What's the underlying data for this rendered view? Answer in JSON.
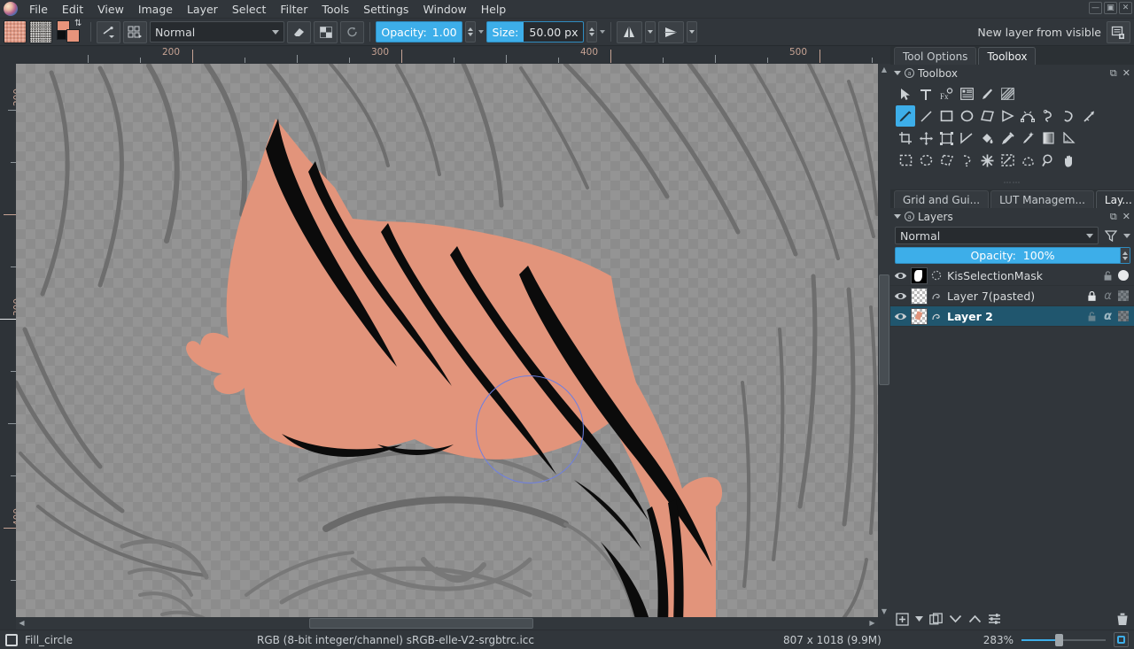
{
  "menu": {
    "items": [
      "File",
      "Edit",
      "View",
      "Image",
      "Layer",
      "Select",
      "Filter",
      "Tools",
      "Settings",
      "Window",
      "Help"
    ]
  },
  "window_controls": {
    "minimize": "—",
    "maximize": "▣",
    "close": "✕"
  },
  "toolbar": {
    "pattern_swatch_name": "brush-pattern-swatch",
    "texture_swatch_name": "texture-pattern-swatch",
    "blend_mode": "Normal",
    "opacity_label": "Opacity:",
    "opacity_value": "1.00",
    "size_label": "Size:",
    "size_value": "50.00 px",
    "eraser_icon": "eraser-icon",
    "alpha_icon": "preserve-alpha-icon",
    "reset_icon": "reload-preset-icon",
    "mirror_h_icon": "mirror-horizontal-icon",
    "mirror_v_icon": "mirror-vertical-icon",
    "brush_editor_icon": "brush-editor-icon",
    "preset_chooser_icon": "preset-chooser-icon",
    "right_action_label": "New layer from visible",
    "right_action_icon": "new-layer-from-visible-icon"
  },
  "rulers": {
    "horizontal_labels": [
      "200",
      "300",
      "400",
      "500"
    ],
    "vertical_labels": [
      "200",
      "300",
      "400"
    ],
    "unit": "px"
  },
  "canvas": {
    "brush_cursor_name": "brush-outline-cursor",
    "artwork_description": "anime hair lineart with peach fill"
  },
  "dock": {
    "top_tabs": [
      {
        "label": "Tool Options",
        "active": false,
        "name": "tab-tool-options"
      },
      {
        "label": "Toolbox",
        "active": true,
        "name": "tab-toolbox"
      }
    ],
    "toolbox": {
      "title": "Toolbox",
      "float_icon": "undock-icon",
      "close_icon": "close-icon",
      "tools": [
        [
          {
            "name": "shape-select-tool",
            "icon": "cursor-arrow-icon",
            "selected": false
          },
          {
            "name": "text-tool",
            "icon": "text-icon",
            "selected": false
          },
          {
            "name": "edit-shapes-tool",
            "icon": "fx-icon",
            "selected": false
          },
          {
            "name": "reference-images-tool",
            "icon": "reference-images-icon",
            "selected": false
          },
          {
            "name": "calligraphy-tool",
            "icon": "calligraphy-icon",
            "selected": false
          },
          {
            "name": "gradient-tool",
            "icon": "pattern-fill-icon",
            "selected": false
          }
        ],
        [
          {
            "name": "freehand-brush-tool",
            "icon": "brush-icon",
            "selected": true
          },
          {
            "name": "line-tool",
            "icon": "line-icon",
            "selected": false
          },
          {
            "name": "rectangle-tool",
            "icon": "rectangle-icon",
            "selected": false
          },
          {
            "name": "ellipse-tool",
            "icon": "ellipse-icon",
            "selected": false
          },
          {
            "name": "polygon-tool",
            "icon": "polygon-icon",
            "selected": false
          },
          {
            "name": "polyline-tool",
            "icon": "polyline-icon",
            "selected": false
          },
          {
            "name": "bezier-curve-tool",
            "icon": "bezier-curve-icon",
            "selected": false
          },
          {
            "name": "freehand-path-tool",
            "icon": "freehand-path-icon",
            "selected": false
          },
          {
            "name": "dynamic-brush-tool",
            "icon": "dynamic-brush-icon",
            "selected": false
          },
          {
            "name": "multibrush-tool",
            "icon": "multibrush-icon",
            "selected": false
          }
        ],
        [
          {
            "name": "crop-tool",
            "icon": "crop-icon",
            "selected": false
          },
          {
            "name": "move-tool",
            "icon": "move-icon",
            "selected": false
          },
          {
            "name": "transform-tool",
            "icon": "transform-icon",
            "selected": false
          },
          {
            "name": "measure-tool",
            "icon": "measure-icon",
            "selected": false
          },
          {
            "name": "fill-tool",
            "icon": "paint-bucket-icon",
            "selected": false
          },
          {
            "name": "color-picker-tool",
            "icon": "eyedropper-icon",
            "selected": false
          },
          {
            "name": "smart-patch-tool",
            "icon": "smart-patch-icon",
            "selected": false
          },
          {
            "name": "gradient-fill-tool",
            "icon": "gradient-icon",
            "selected": false
          },
          {
            "name": "assistant-tool",
            "icon": "assistant-ruler-icon",
            "selected": false
          }
        ],
        [
          {
            "name": "rectangular-selection-tool",
            "icon": "select-rect-icon",
            "selected": false
          },
          {
            "name": "elliptical-selection-tool",
            "icon": "select-ellipse-icon",
            "selected": false
          },
          {
            "name": "polygonal-selection-tool",
            "icon": "select-polygon-icon",
            "selected": false
          },
          {
            "name": "freehand-selection-tool",
            "icon": "select-freehand-icon",
            "selected": false
          },
          {
            "name": "contiguous-selection-tool",
            "icon": "magic-wand-icon",
            "selected": false
          },
          {
            "name": "similar-color-selection-tool",
            "icon": "select-similar-icon",
            "selected": false
          },
          {
            "name": "bezier-selection-tool",
            "icon": "select-bezier-icon",
            "selected": false
          },
          {
            "name": "zoom-tool",
            "icon": "magnifier-icon",
            "selected": false
          },
          {
            "name": "pan-tool",
            "icon": "hand-icon",
            "selected": false
          }
        ]
      ]
    },
    "mid_tabs": [
      {
        "label": "Grid and Gui...",
        "active": false,
        "name": "tab-grid-and-guides"
      },
      {
        "label": "LUT Managem...",
        "active": false,
        "name": "tab-lut-management"
      },
      {
        "label": "Lay...",
        "active": true,
        "name": "tab-layers"
      }
    ],
    "layers": {
      "title": "Layers",
      "float_icon": "undock-icon",
      "close_icon": "close-icon",
      "blend_mode": "Normal",
      "filter_icon": "filter-funnel-icon",
      "opacity_label": "Opacity:",
      "opacity_value": "100%",
      "rows": [
        {
          "name": "KisSelectionMask",
          "visible": true,
          "selected": false,
          "thumb_type": "mask",
          "type_icon": "selection-mask-icon",
          "locked": false,
          "has_alpha_lock": false,
          "has_dot": true
        },
        {
          "name": "Layer 7(pasted)",
          "visible": true,
          "selected": false,
          "thumb_type": "checker",
          "type_icon": "paint-layer-icon",
          "locked": true,
          "has_alpha_lock": true,
          "has_dot": false
        },
        {
          "name": "Layer 2",
          "visible": true,
          "selected": true,
          "thumb_type": "checker",
          "type_icon": "paint-layer-icon",
          "locked": false,
          "has_alpha_lock": true,
          "has_dot": false
        }
      ],
      "toolbar_buttons": [
        {
          "name": "add-layer-button",
          "icon": "plus-box-icon"
        },
        {
          "name": "add-layer-dropdown",
          "icon": "chevron-down-icon"
        },
        {
          "name": "duplicate-layer-button",
          "icon": "duplicate-icon"
        },
        {
          "name": "move-layer-down-button",
          "icon": "chevron-down-icon"
        },
        {
          "name": "move-layer-up-button",
          "icon": "chevron-up-icon"
        },
        {
          "name": "layer-properties-button",
          "icon": "sliders-icon"
        },
        {
          "name": "delete-layer-button",
          "icon": "trash-icon"
        }
      ]
    }
  },
  "statusbar": {
    "selection_icon": "selection-mode-icon",
    "tool_preset": "Fill_circle",
    "color_info": "RGB (8-bit integer/channel)  sRGB-elle-V2-srgbtrc.icc",
    "dimensions": "807 x 1018 (9.9M)",
    "zoom": "283%",
    "fit_icon": "fit-page-icon"
  },
  "colors": {
    "accent": "#3daee9",
    "window_bg": "#31363b",
    "selection_row": "#20566e",
    "skin": "#e2947b",
    "ruler_text": "#c6a394"
  }
}
